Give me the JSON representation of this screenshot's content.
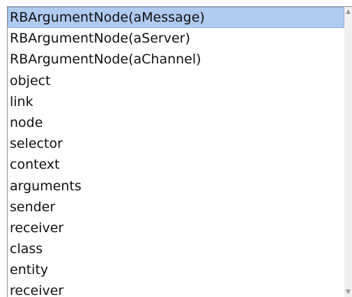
{
  "list": {
    "items": [
      "RBArgumentNode(aMessage)",
      "RBArgumentNode(aServer)",
      "RBArgumentNode(aChannel)",
      "object",
      "link",
      "node",
      "selector",
      "context",
      "arguments",
      "sender",
      "receiver",
      "class",
      "entity",
      "receiver"
    ],
    "selected_index": 0
  },
  "scrollbar": {
    "up_icon": "▲",
    "down_icon": "▼"
  },
  "colors": {
    "selection_background": "#afcbf0",
    "selection_border": "#8eb1e0",
    "text": "#111111",
    "border": "#8e8f8f"
  }
}
